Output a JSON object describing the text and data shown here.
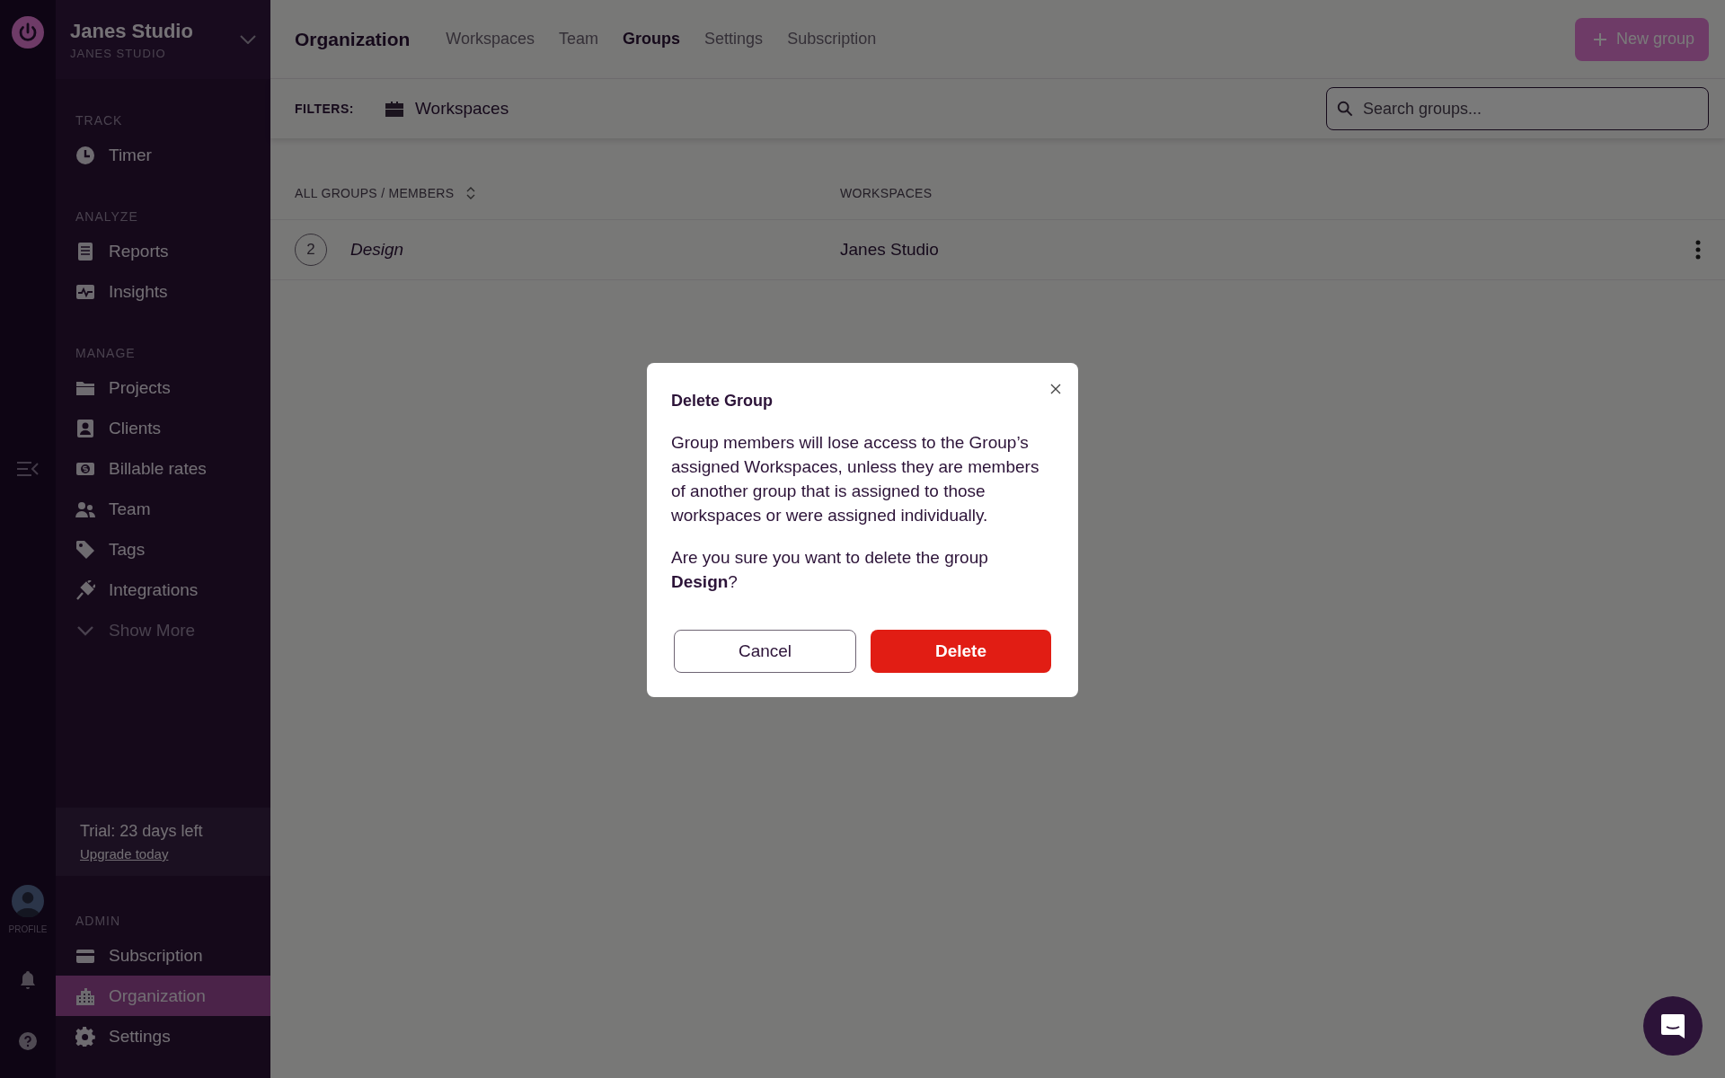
{
  "workspace": {
    "name": "Janes Studio",
    "subtitle": "JANES STUDIO"
  },
  "rail": {
    "profile_label": "PROFILE"
  },
  "sidebar": {
    "sections": [
      {
        "heading": "TRACK",
        "items": [
          {
            "label": "Timer",
            "kind": "link",
            "selected": false
          }
        ]
      },
      {
        "heading": "ANALYZE",
        "items": [
          {
            "label": "Reports",
            "kind": "link",
            "selected": false
          },
          {
            "label": "Insights",
            "kind": "link",
            "selected": false
          }
        ]
      },
      {
        "heading": "MANAGE",
        "items": [
          {
            "label": "Projects",
            "kind": "link",
            "selected": false
          },
          {
            "label": "Clients",
            "kind": "link",
            "selected": false
          },
          {
            "label": "Billable rates",
            "kind": "link",
            "selected": false
          },
          {
            "label": "Team",
            "kind": "link",
            "selected": false
          },
          {
            "label": "Tags",
            "kind": "link",
            "selected": false
          },
          {
            "label": "Integrations",
            "kind": "link",
            "selected": false
          },
          {
            "label": "Show More",
            "kind": "more",
            "selected": false
          }
        ]
      }
    ],
    "trial": {
      "text": "Trial: 23 days left",
      "link": "Upgrade today"
    },
    "admin_section": {
      "heading": "ADMIN",
      "items": [
        {
          "label": "Subscription",
          "kind": "link",
          "selected": false
        },
        {
          "label": "Organization",
          "kind": "link",
          "selected": true
        },
        {
          "label": "Settings",
          "kind": "link",
          "selected": false
        }
      ]
    }
  },
  "header": {
    "title": "Organization",
    "tabs": [
      {
        "label": "Workspaces",
        "selected": false
      },
      {
        "label": "Team",
        "selected": false
      },
      {
        "label": "Groups",
        "selected": true
      },
      {
        "label": "Settings",
        "selected": false
      },
      {
        "label": "Subscription",
        "selected": false
      }
    ],
    "new_button": "New group"
  },
  "filters": {
    "label": "FILTERS:",
    "filter": "Workspaces",
    "search": {
      "placeholder": "Search groups..."
    }
  },
  "table": {
    "columns": [
      "ALL GROUPS / MEMBERS",
      "WORKSPACES"
    ],
    "rows": [
      {
        "members": "2",
        "name": "Design",
        "workspaces": "Janes Studio"
      }
    ]
  },
  "dialog": {
    "title": "Delete Group",
    "message": "Group members will lose access to the Group’s assigned Workspaces, unless they are members of another group that is assigned to those workspaces or were assigned individually.",
    "question": "Are you sure you want to delete the group **Design**?",
    "buttons": [
      {
        "label": "Cancel",
        "kind": "secondary"
      },
      {
        "label": "Delete",
        "kind": "danger"
      }
    ]
  }
}
